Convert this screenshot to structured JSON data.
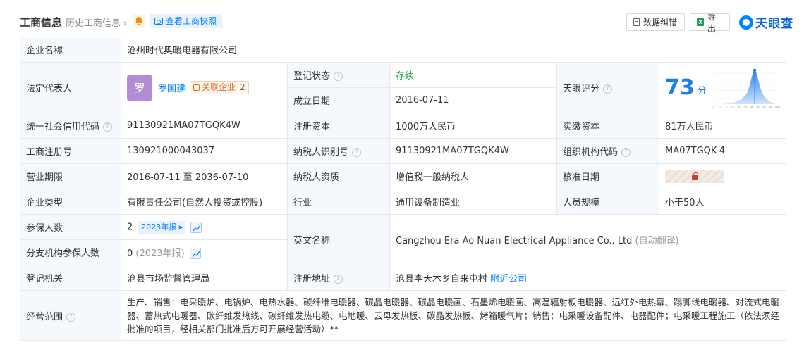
{
  "header": {
    "title": "工商信息",
    "history": "历史工商信息",
    "snapshot": "查看工商快照",
    "correct_btn": "数据纠错",
    "export_btn": "导出",
    "logo_text": "天眼查",
    "accent": "#0084ff"
  },
  "company": {
    "name_label": "企业名称",
    "name": "沧州时代奥暖电器有限公司",
    "legal_rep_label": "法定代表人",
    "legal_rep_avatar": "罗",
    "legal_rep": "罗国建",
    "related_label": "关联企业",
    "related_count": "2",
    "reg_status_label": "登记状态",
    "reg_status": "存续",
    "founded_label": "成立日期",
    "founded": "2016-07-11",
    "score_label": "天眼评分",
    "score": "73",
    "score_unit": "分",
    "credit_code_label": "统一社会信用代码",
    "credit_code": "91130921MA07TGQK4W",
    "reg_capital_label": "注册资本",
    "reg_capital": "1000万人民币",
    "paid_capital_label": "实缴资本",
    "paid_capital": "81万人民币",
    "reg_no_label": "工商注册号",
    "reg_no": "130921000043037",
    "taxpayer_id_label": "纳税人识别号",
    "taxpayer_id": "91130921MA07TGQK4W",
    "org_code_label": "组织机构代码",
    "org_code": "MA07TGQK-4",
    "term_label": "营业期限",
    "term": "2016-07-11 至 2036-07-10",
    "taxpayer_qual_label": "纳税人资质",
    "taxpayer_qual": "增值税一般纳税人",
    "approval_date_label": "核准日期",
    "type_label": "企业类型",
    "type": "有限责任公司(自然人投资或控股)",
    "industry_label": "行业",
    "industry": "通用设备制造业",
    "staff_label": "人员规模",
    "staff": "小于50人",
    "insured_label": "参保人数",
    "insured": "2",
    "insured_report": "2023年报",
    "english_name_label": "英文名称",
    "english_name": "Cangzhou Era Ao Nuan Electrical Appliance Co., Ltd",
    "auto_translate": "(自动翻译)",
    "branch_insured_label": "分支机构参保人数",
    "branch_insured": "0",
    "branch_insured_year": "(2023年报)",
    "authority_label": "登记机关",
    "authority": "沧县市场监督管理局",
    "address_label": "注册地址",
    "address": "沧县李天木乡自来屯村",
    "nearby": "附近公司",
    "scope_label": "经营范围",
    "scope": "生产、销售：电采暖炉、电锅炉、电热水器、碳纤维电暖器、碳晶电暖器、碳晶电暖画、石墨烯电暖画、高温辐射板电暖器、远红外电热幕、踢脚线电暖器、对流式电暖器、蓄热式电暖器、碳纤维发热线、碳纤维发热电缆、电地暖、云母发热板、碳晶发热板、烤箱暖气片；销售：电采暖设备配件、电器配件；电采暖工程施工（依法须经批准的项目，经相关部门批准后方可开展经营活动）**"
  },
  "score_chart": {
    "x_ticks": [
      "0",
      "1",
      "5",
      "10",
      "20",
      "50",
      "80",
      "90",
      "95",
      "99",
      "100"
    ]
  }
}
